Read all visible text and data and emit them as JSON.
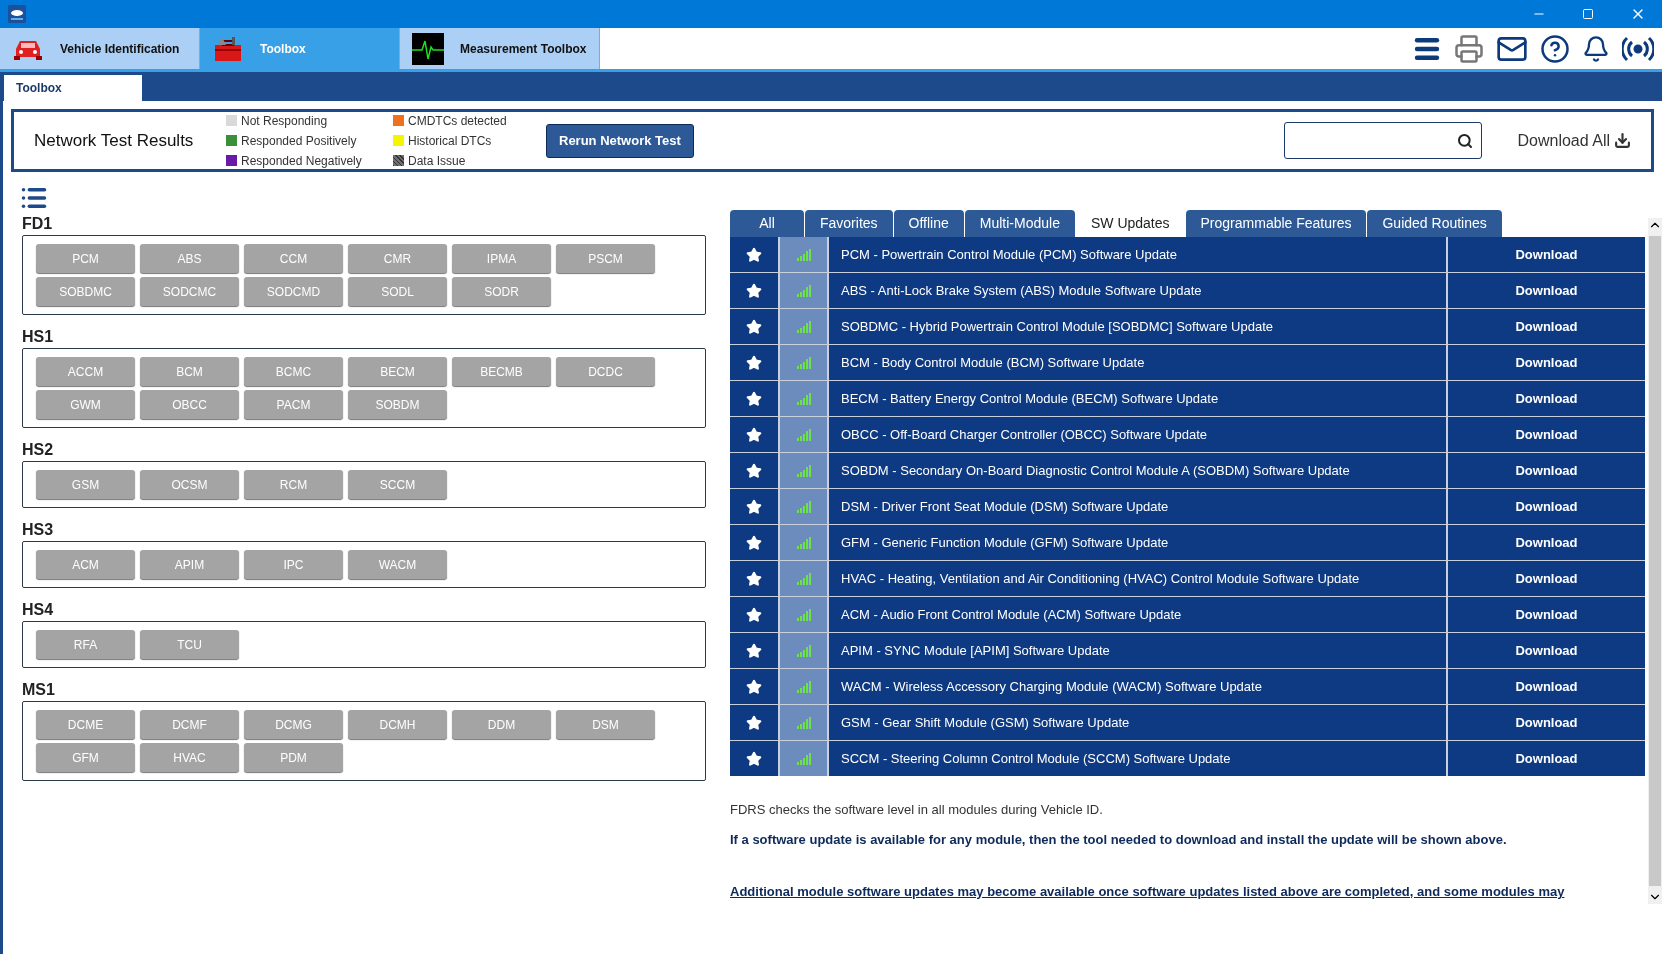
{
  "app_tabs": [
    {
      "label": "Vehicle Identification",
      "kind": "car",
      "selected": false
    },
    {
      "label": "Toolbox",
      "kind": "toolbox",
      "selected": true
    },
    {
      "label": "Measurement Toolbox",
      "kind": "scope",
      "selected": false
    }
  ],
  "sub_tabs": [
    {
      "label": "Toolbox",
      "selected": true
    }
  ],
  "network_test": {
    "title": "Network Test Results",
    "legend": [
      {
        "label": "Not Responding",
        "color": "#d9d9d9",
        "kind": "solid"
      },
      {
        "label": "Responded Positively",
        "color": "#3a8f3a",
        "kind": "solid"
      },
      {
        "label": "Responded Negatively",
        "color": "#6a1aa8",
        "kind": "solid"
      },
      {
        "label": "CMDTCs detected",
        "color": "#f07020",
        "kind": "solid"
      },
      {
        "label": "Historical DTCs",
        "color": "#f5f500",
        "kind": "solid"
      },
      {
        "label": "Data Issue",
        "color": "#707070",
        "kind": "hatched"
      }
    ],
    "rerun_button": "Rerun Network Test",
    "download_all": "Download All"
  },
  "networks": [
    {
      "name": "FD1",
      "modules": [
        "PCM",
        "ABS",
        "CCM",
        "CMR",
        "IPMA",
        "PSCM",
        "SOBDMC",
        "SODCMC",
        "SODCMD",
        "SODL",
        "SODR"
      ]
    },
    {
      "name": "HS1",
      "modules": [
        "ACCM",
        "BCM",
        "BCMC",
        "BECM",
        "BECMB",
        "DCDC",
        "GWM",
        "OBCC",
        "PACM",
        "SOBDM"
      ]
    },
    {
      "name": "HS2",
      "modules": [
        "GSM",
        "OCSM",
        "RCM",
        "SCCM"
      ]
    },
    {
      "name": "HS3",
      "modules": [
        "ACM",
        "APIM",
        "IPC",
        "WACM"
      ]
    },
    {
      "name": "HS4",
      "modules": [
        "RFA",
        "TCU"
      ]
    },
    {
      "name": "MS1",
      "modules": [
        "DCME",
        "DCMF",
        "DCMG",
        "DCMH",
        "DDM",
        "DSM",
        "GFM",
        "HVAC",
        "PDM"
      ]
    }
  ],
  "filter_tabs": [
    {
      "label": "All",
      "selected": false
    },
    {
      "label": "Favorites",
      "selected": false
    },
    {
      "label": "Offline",
      "selected": false
    },
    {
      "label": "Multi-Module",
      "selected": false
    },
    {
      "label": "SW Updates",
      "selected": true
    },
    {
      "label": "Programmable Features",
      "selected": false
    },
    {
      "label": "Guided Routines",
      "selected": false
    }
  ],
  "updates": [
    {
      "title": "PCM - Powertrain Control Module (PCM) Software Update",
      "action": "Download"
    },
    {
      "title": "ABS - Anti-Lock Brake System (ABS) Module Software Update",
      "action": "Download"
    },
    {
      "title": "SOBDMC - Hybrid Powertrain Control Module [SOBDMC] Software Update",
      "action": "Download"
    },
    {
      "title": "BCM - Body Control Module (BCM) Software Update",
      "action": "Download"
    },
    {
      "title": "BECM - Battery Energy Control Module (BECM) Software Update",
      "action": "Download"
    },
    {
      "title": "OBCC - Off-Board Charger Controller (OBCC) Software Update",
      "action": "Download"
    },
    {
      "title": "SOBDM - Secondary On-Board Diagnostic Control Module A (SOBDM) Software Update",
      "action": "Download"
    },
    {
      "title": "DSM - Driver Front Seat Module (DSM) Software Update",
      "action": "Download"
    },
    {
      "title": "GFM - Generic Function Module (GFM) Software Update",
      "action": "Download"
    },
    {
      "title": "HVAC - Heating, Ventilation and Air Conditioning (HVAC) Control Module Software Update",
      "action": "Download"
    },
    {
      "title": "ACM - Audio Front Control Module (ACM) Software Update",
      "action": "Download"
    },
    {
      "title": "APIM - SYNC Module [APIM] Software Update",
      "action": "Download"
    },
    {
      "title": "WACM - Wireless Accessory Charging Module (WACM) Software Update",
      "action": "Download"
    },
    {
      "title": "GSM - Gear Shift Module (GSM) Software Update",
      "action": "Download"
    },
    {
      "title": "SCCM - Steering Column Control Module (SCCM) Software Update",
      "action": "Download"
    }
  ],
  "notes": [
    {
      "kind": "plain",
      "text": "FDRS checks the software level in all modules during Vehicle ID."
    },
    {
      "kind": "bold",
      "text": "If a software update is available for any module, then the tool needed to download and install the update will be shown above."
    },
    {
      "kind": "link",
      "text": "Additional module software updates may become available once software updates listed above are completed, and some modules may"
    }
  ]
}
